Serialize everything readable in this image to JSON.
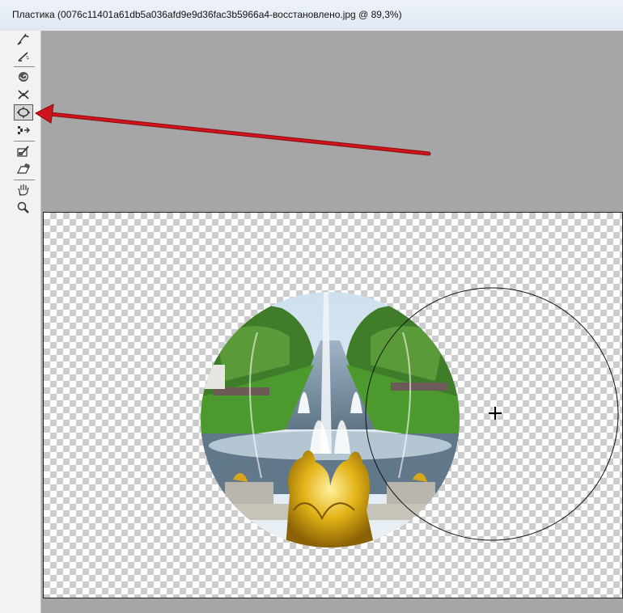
{
  "window": {
    "title": "Пластика (0076c11401a61db5a036afd9e9d36fac3b5966a4-восстановлено.jpg @ 89,3%)"
  },
  "toolbar": {
    "tools": [
      {
        "icon": "forward-warp-tool-icon"
      },
      {
        "icon": "reconstruct-tool-icon"
      },
      {
        "icon": "twirl-clockwise-tool-icon"
      },
      {
        "icon": "pucker-tool-icon"
      },
      {
        "icon": "bloat-tool-icon",
        "active": true
      },
      {
        "icon": "push-left-tool-icon"
      },
      {
        "icon": "freeze-mask-tool-icon"
      },
      {
        "icon": "thaw-mask-tool-icon"
      },
      {
        "icon": "hand-tool-icon"
      },
      {
        "icon": "zoom-tool-icon"
      }
    ]
  },
  "colors": {
    "annotation_arrow": "#d0141c",
    "workspace": "#a6a6a6",
    "checker": "#cccccc"
  },
  "canvas": {
    "content": "circular-photo-of-fountain-with-golden-statues",
    "brush_cursor": "crosshair-with-circle"
  }
}
